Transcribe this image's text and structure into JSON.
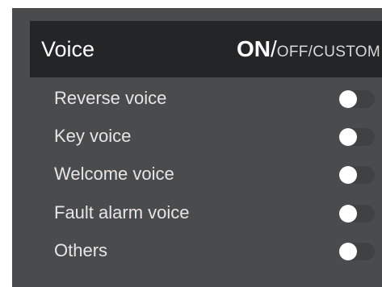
{
  "header": {
    "title": "Voice",
    "mode_selected": "ON",
    "mode_separator": "/",
    "mode_others": "OFF/CUSTOM"
  },
  "settings": [
    {
      "label": "Reverse voice",
      "enabled": true
    },
    {
      "label": "Key voice",
      "enabled": true
    },
    {
      "label": "Welcome voice",
      "enabled": true
    },
    {
      "label": "Fault alarm voice",
      "enabled": true
    },
    {
      "label": "Others",
      "enabled": true
    }
  ],
  "colors": {
    "panel_bg": "#4a4b4d",
    "header_bg": "#242527",
    "text": "#ffffff",
    "knob": "#ffffff"
  }
}
